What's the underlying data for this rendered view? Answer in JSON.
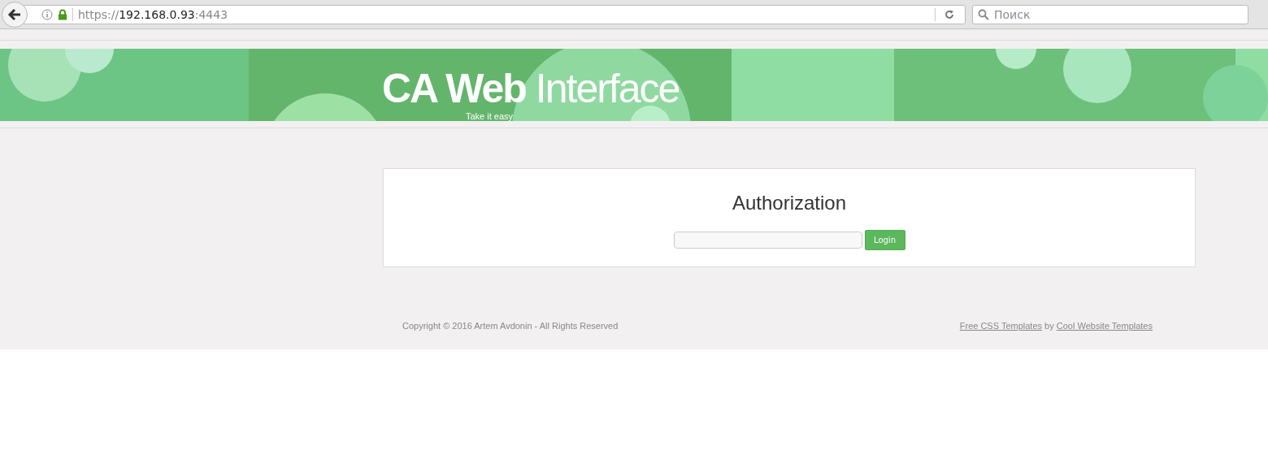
{
  "browser": {
    "url": {
      "scheme": "https://",
      "host": "192.168.0.93",
      "port": ":4443"
    },
    "search": {
      "placeholder": "Поиск"
    }
  },
  "header": {
    "title": "**CA Web** Interface",
    "tagline": "Take it easy"
  },
  "auth": {
    "heading": "Authorization",
    "button": "Login"
  },
  "footer": {
    "copyright": "Copyright © 2016 Artem Avdonin - All Rights Reserved",
    "links": [
      {
        "text": "Free CSS Templates"
      },
      {
        "text": "Cool Website Templates"
      }
    ],
    "joiner": "by"
  }
}
